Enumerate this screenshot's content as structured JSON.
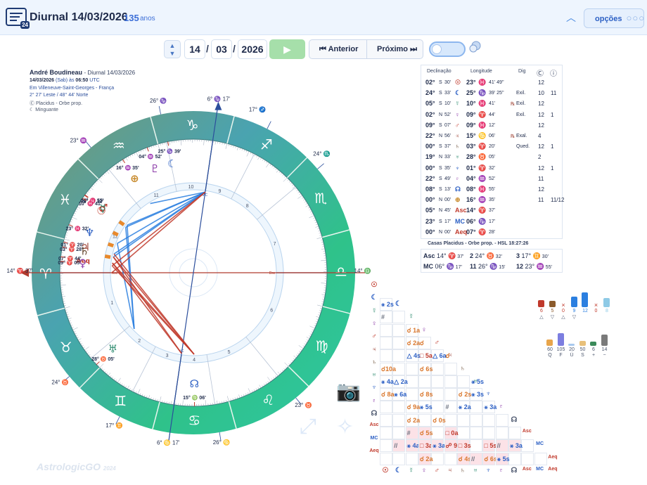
{
  "header": {
    "title": "Diurnal 14/03/2026",
    "age_value": "135",
    "age_unit": "anos",
    "logo_badge": "24",
    "options_label": "opções"
  },
  "toolbar": {
    "day": "14",
    "month": "03",
    "year": "2026",
    "prev_label": "Anterior",
    "next_label": "Próximo"
  },
  "chart_info": {
    "name": "André Boudineau",
    "chart_label": "- Diurnal 14/03/2026",
    "date": "14/03/2026",
    "weekday_note": "(Sab) às",
    "time": "06:50",
    "tz": "UTC",
    "place_prefix": "Em",
    "place": "Villeneuve-Saint-Georges - França",
    "coords": "2° 27' Leste / 48° 44' Norte",
    "house_system": "Placidus - Orbe prop.",
    "moon_phase": "Minguante"
  },
  "wheel": {
    "cusp_labels": [
      {
        "text": "14°",
        "sub": "37'",
        "sign": "♈"
      },
      {
        "text": "14°",
        "sub": "37'",
        "sign": "♎"
      },
      {
        "text": "6°",
        "sub": "17'",
        "sign": "♑"
      },
      {
        "text": "6°",
        "sub": "17'",
        "sign": "♋"
      },
      {
        "text": "26°",
        "sign": "♑"
      },
      {
        "text": "17°",
        "sign": "♐"
      },
      {
        "text": "24°",
        "sign": "♏"
      },
      {
        "text": "23°",
        "sign": "♒"
      },
      {
        "text": "23°",
        "sign": "♉"
      },
      {
        "text": "24°",
        "sign": "♉"
      },
      {
        "text": "17°",
        "sign": "♊"
      },
      {
        "text": "26°",
        "sign": "♋"
      }
    ],
    "house_numbers": [
      "1",
      "2",
      "3",
      "4",
      "5",
      "6",
      "7",
      "8",
      "9",
      "10",
      "11",
      "12"
    ],
    "angles": {
      "asc": "Asc",
      "dsc": "Dsc",
      "mc": "MC",
      "ic": "IC"
    },
    "planets": [
      {
        "glyph": "♇",
        "deg": "04°",
        "sign": "♒",
        "min": "52'",
        "color": "#8b3aa8"
      },
      {
        "glyph": "☾",
        "deg": "25°",
        "sign": "♑",
        "min": "39'",
        "color": "#2b5fc4"
      },
      {
        "glyph": "⊕",
        "deg": "16°",
        "sign": "♒",
        "min": "35'",
        "color": "#c78a2b"
      },
      {
        "glyph": "♂",
        "deg": "08°",
        "sign": "♓",
        "min": "55'",
        "color": "#c0392b"
      },
      {
        "glyph": "☿",
        "deg": "09°",
        "sign": "♓",
        "min": "12'",
        "color": "#2b8a6e"
      },
      {
        "glyph": "☉",
        "deg": "10°",
        "sign": "♓",
        "min": "41'",
        "color": "#c0392b"
      },
      {
        "glyph": "♆",
        "deg": "23°",
        "sign": "♓",
        "min": "32'",
        "color": "#2b5fc4"
      },
      {
        "glyph": "♃",
        "deg": "01°",
        "sign": "♈",
        "min": "20'",
        "color": "#9a3b2c"
      },
      {
        "glyph": "♄",
        "deg": "03°",
        "sign": "♈",
        "min": "28'",
        "color": "#5a3a20"
      },
      {
        "glyph": "Aeq",
        "deg": "07°",
        "sign": "♈",
        "min": "44'",
        "color": "#c0392b"
      },
      {
        "glyph": "♀",
        "deg": "09°",
        "sign": "♈",
        "min": "05'",
        "color": "#8b3aa8"
      },
      {
        "glyph": "♅",
        "deg": "28°",
        "sign": "♉",
        "min": "05'",
        "color": "#2b8a6e"
      },
      {
        "glyph": "☊",
        "deg": "15°",
        "sign": "♍",
        "min": "06'",
        "color": "#2b5fc4"
      }
    ]
  },
  "positions": {
    "headers": {
      "decl": "Declinação",
      "long": "Longitude",
      "dig": "Dig"
    },
    "rows": [
      {
        "deg": "02°",
        "dir": "S",
        "min": "30'",
        "pl": "☉",
        "pc": "#c0392b",
        "ldeg": "23°",
        "sg": "♓",
        "sc": "#2b5fc4",
        "lmin": "41' 49''",
        "rx": "",
        "dig": "",
        "c1": "12",
        "c2": ""
      },
      {
        "deg": "24°",
        "dir": "S",
        "min": "33'",
        "pl": "☾",
        "pc": "#2b5fc4",
        "ldeg": "25°",
        "sg": "♑",
        "sc": "#5a3a20",
        "lmin": "39' 25''",
        "rx": "",
        "dig": "Exil.",
        "c1": "10",
        "c2": "11"
      },
      {
        "deg": "05°",
        "dir": "S",
        "min": "10'",
        "pl": "☿",
        "pc": "#2b8a6e",
        "ldeg": "10°",
        "sg": "♓",
        "sc": "#2b5fc4",
        "lmin": "41'",
        "rx": "℞",
        "dig": "Exil.",
        "c1": "12",
        "c2": ""
      },
      {
        "deg": "02°",
        "dir": "N",
        "min": "52'",
        "pl": "♀",
        "pc": "#8b3aa8",
        "ldeg": "09°",
        "sg": "♈",
        "sc": "#c0392b",
        "lmin": "44'",
        "rx": "",
        "dig": "Exil.",
        "c1": "12",
        "c2": "1"
      },
      {
        "deg": "09°",
        "dir": "S",
        "min": "07'",
        "pl": "♂",
        "pc": "#c0392b",
        "ldeg": "09°",
        "sg": "♓",
        "sc": "#2b5fc4",
        "lmin": "12'",
        "rx": "",
        "dig": "",
        "c1": "12",
        "c2": ""
      },
      {
        "deg": "22°",
        "dir": "N",
        "min": "56'",
        "pl": "♃",
        "pc": "#9a3b2c",
        "ldeg": "15°",
        "sg": "♋",
        "sc": "#2b8a6e",
        "lmin": "06'",
        "rx": "℞",
        "dig": "Exal.",
        "c1": "4",
        "c2": ""
      },
      {
        "deg": "00°",
        "dir": "S",
        "min": "37'",
        "pl": "♄",
        "pc": "#5a3a20",
        "ldeg": "03°",
        "sg": "♈",
        "sc": "#c0392b",
        "lmin": "20'",
        "rx": "",
        "dig": "Qued.",
        "c1": "12",
        "c2": "1"
      },
      {
        "deg": "19°",
        "dir": "N",
        "min": "33'",
        "pl": "♅",
        "pc": "#2b8a6e",
        "ldeg": "28°",
        "sg": "♉",
        "sc": "#2b8a6e",
        "lmin": "05'",
        "rx": "",
        "dig": "",
        "c1": "2",
        "c2": ""
      },
      {
        "deg": "00°",
        "dir": "S",
        "min": "35'",
        "pl": "♆",
        "pc": "#2b5fc4",
        "ldeg": "01°",
        "sg": "♈",
        "sc": "#c0392b",
        "lmin": "32'",
        "rx": "",
        "dig": "",
        "c1": "12",
        "c2": "1"
      },
      {
        "deg": "22°",
        "dir": "S",
        "min": "49'",
        "pl": "♇",
        "pc": "#8b3aa8",
        "ldeg": "04°",
        "sg": "♒",
        "sc": "#2b5fc4",
        "lmin": "52'",
        "rx": "",
        "dig": "",
        "c1": "11",
        "c2": ""
      },
      {
        "deg": "08°",
        "dir": "S",
        "min": "13'",
        "pl": "☊",
        "pc": "#2b5fc4",
        "ldeg": "08°",
        "sg": "♓",
        "sc": "#2b5fc4",
        "lmin": "55'",
        "rx": "",
        "dig": "",
        "c1": "12",
        "c2": ""
      },
      {
        "deg": "00°",
        "dir": "N",
        "min": "00'",
        "pl": "⊕",
        "pc": "#c78a2b",
        "ldeg": "16°",
        "sg": "♒",
        "sc": "#2b5fc4",
        "lmin": "35'",
        "rx": "",
        "dig": "",
        "c1": "11",
        "c2": "11/12"
      },
      {
        "deg": "05°",
        "dir": "N",
        "min": "45'",
        "pl": "Asc",
        "pc": "#c0392b",
        "ldeg": "14°",
        "sg": "♈",
        "sc": "#c0392b",
        "lmin": "37'",
        "rx": "",
        "dig": "",
        "c1": "",
        "c2": ""
      },
      {
        "deg": "23°",
        "dir": "S",
        "min": "17'",
        "pl": "MC",
        "pc": "#2b5fc4",
        "ldeg": "06°",
        "sg": "♑",
        "sc": "#5a3a20",
        "lmin": "17'",
        "rx": "",
        "dig": "",
        "c1": "",
        "c2": ""
      },
      {
        "deg": "00°",
        "dir": "N",
        "min": "00'",
        "pl": "Aeq",
        "pc": "#c0392b",
        "ldeg": "07°",
        "sg": "♈",
        "sc": "#c0392b",
        "lmin": "28'",
        "rx": "",
        "dig": "",
        "c1": "",
        "c2": ""
      }
    ]
  },
  "houses": {
    "title": "Casas Placidus - Orbe prop. - HSL 18:27:26",
    "cells": [
      {
        "n": "Asc",
        "deg": "14°",
        "sg": "♈",
        "sc": "#c0392b",
        "min": "37'"
      },
      {
        "n": "2",
        "deg": "24°",
        "sg": "♉",
        "sc": "#2b8a6e",
        "min": "32'"
      },
      {
        "n": "3",
        "deg": "17°",
        "sg": "♊",
        "sc": "#c78a2b",
        "min": "30'"
      },
      {
        "n": "MC",
        "deg": "06°",
        "sg": "♑",
        "sc": "#5a3a20",
        "min": "17'"
      },
      {
        "n": "11",
        "deg": "26°",
        "sg": "♑",
        "sc": "#5a3a20",
        "min": "15'"
      },
      {
        "n": "12",
        "deg": "23°",
        "sg": "♒",
        "sc": "#2b5fc4",
        "min": "55'"
      }
    ]
  },
  "aspect_grid": {
    "row_glyphs": [
      "☉",
      "☾",
      "☿",
      "♀",
      "♂",
      "♃",
      "♄",
      "♅",
      "♆",
      "♇",
      "☊",
      "Asc",
      "MC",
      "Aeq"
    ],
    "row_colors": [
      "#c0392b",
      "#2b5fc4",
      "#2b8a6e",
      "#8b3aa8",
      "#c0392b",
      "#9a3b2c",
      "#5a3a20",
      "#2b8a6e",
      "#2b5fc4",
      "#8b3aa8",
      "#4b566d",
      "#c0392b",
      "#2b5fc4",
      "#c0392b"
    ],
    "cells": [
      {
        "r": 1,
        "c": 0,
        "t": "⚹ 2s",
        "k": "#2b5fc4"
      },
      {
        "r": 2,
        "c": 0,
        "t": "#",
        "k": "#6b7280"
      },
      {
        "r": 3,
        "c": 2,
        "t": "☌ 1a",
        "k": "#d9762b"
      },
      {
        "r": 4,
        "c": 2,
        "t": "☌ 2a",
        "k": "#d9762b"
      },
      {
        "r": 4,
        "c": 3,
        "t": "☌",
        "k": "#d9762b"
      },
      {
        "r": 5,
        "c": 2,
        "t": "△ 4s",
        "k": "#2b5fc4"
      },
      {
        "r": 5,
        "c": 3,
        "t": "□ 5a",
        "k": "#c0392b"
      },
      {
        "r": 5,
        "c": 4,
        "t": "△ 6a",
        "k": "#2b5fc4"
      },
      {
        "r": 5,
        "c": 5,
        "t": "☌",
        "k": "#d9762b"
      },
      {
        "r": 6,
        "c": 0,
        "t": "☌10a",
        "k": "#d9762b"
      },
      {
        "r": 6,
        "c": 3,
        "t": "☌ 6s",
        "k": "#d9762b"
      },
      {
        "r": 7,
        "c": 0,
        "t": "⚹ 4a",
        "k": "#2b5fc4"
      },
      {
        "r": 7,
        "c": 1,
        "t": "△ 2a",
        "k": "#2b5fc4"
      },
      {
        "r": 7,
        "c": 7,
        "t": "⚹ 5s",
        "k": "#2b5fc4"
      },
      {
        "r": 8,
        "c": 0,
        "t": "☌ 8a",
        "k": "#d9762b"
      },
      {
        "r": 8,
        "c": 1,
        "t": "⚹ 6a",
        "k": "#2b5fc4"
      },
      {
        "r": 8,
        "c": 3,
        "t": "☌ 8s",
        "k": "#d9762b"
      },
      {
        "r": 8,
        "c": 6,
        "t": "☌ 2s",
        "k": "#d9762b"
      },
      {
        "r": 8,
        "c": 7,
        "t": "⚹ 3s",
        "k": "#2b5fc4"
      },
      {
        "r": 9,
        "c": 2,
        "t": "☌ 9a",
        "k": "#d9762b"
      },
      {
        "r": 9,
        "c": 3,
        "t": "⚹ 5s",
        "k": "#2b5fc4"
      },
      {
        "r": 9,
        "c": 5,
        "t": "#",
        "k": "#6b7280"
      },
      {
        "r": 9,
        "c": 6,
        "t": "⚹ 2a",
        "k": "#2b5fc4"
      },
      {
        "r": 9,
        "c": 8,
        "t": "⚹ 3a",
        "k": "#2b5fc4"
      },
      {
        "r": 10,
        "c": 2,
        "t": "☌ 2a",
        "k": "#d9762b"
      },
      {
        "r": 10,
        "c": 4,
        "t": "☌ 0s",
        "k": "#d9762b"
      },
      {
        "r": 11,
        "c": 2,
        "t": "#",
        "k": "#6b7280"
      },
      {
        "r": 11,
        "c": 3,
        "t": "☌ 5s",
        "k": "#d9762b"
      },
      {
        "r": 11,
        "c": 5,
        "t": "□ 0a",
        "k": "#c0392b"
      },
      {
        "r": 12,
        "c": 1,
        "t": "//",
        "k": "#6b7280"
      },
      {
        "r": 12,
        "c": 2,
        "t": "⚹ 4a",
        "k": "#2b5fc4"
      },
      {
        "r": 12,
        "c": 3,
        "t": "□ 3a",
        "k": "#c0392b"
      },
      {
        "r": 12,
        "c": 4,
        "t": "⚹ 3a",
        "k": "#2b5fc4"
      },
      {
        "r": 12,
        "c": 5,
        "t": "☍ 9a",
        "k": "#c0392b"
      },
      {
        "r": 12,
        "c": 6,
        "t": "□ 3s",
        "k": "#c0392b"
      },
      {
        "r": 12,
        "c": 8,
        "t": "□ 5s",
        "k": "#c0392b"
      },
      {
        "r": 12,
        "c": 9,
        "t": "//",
        "k": "#6b7280"
      },
      {
        "r": 12,
        "c": 10,
        "t": "⚹ 3a",
        "k": "#2b5fc4"
      },
      {
        "r": 13,
        "c": 3,
        "t": "☌ 2a",
        "k": "#d9762b"
      },
      {
        "r": 13,
        "c": 6,
        "t": "☌ 4s",
        "k": "#d9762b"
      },
      {
        "r": 13,
        "c": 7,
        "t": "//",
        "k": "#6b7280"
      },
      {
        "r": 13,
        "c": 8,
        "t": "☌ 6s",
        "k": "#d9762b"
      },
      {
        "r": 13,
        "c": 9,
        "t": "⚹ 5s",
        "k": "#2b5fc4"
      }
    ]
  },
  "elements_chart": {
    "top": [
      {
        "v": "6",
        "sym": "△",
        "c": "#c0392b",
        "h": 0.35
      },
      {
        "v": "5",
        "sym": "▽",
        "c": "#8b5a2b",
        "h": 0.3
      },
      {
        "v": "0",
        "sym": "△",
        "c": "#c0392b",
        "h": 0.0,
        "x": true
      },
      {
        "v": "9",
        "sym": "▽",
        "c": "#2b7fe0",
        "h": 0.5
      },
      {
        "v": "12",
        "sym": "",
        "c": "#2b7fe0",
        "h": 0.7
      },
      {
        "v": "0",
        "sym": "",
        "c": "#c0392b",
        "h": 0.0,
        "x": true
      },
      {
        "v": "8",
        "sym": "",
        "c": "#8ecae6",
        "h": 0.45
      }
    ],
    "bottom": [
      {
        "v": "60",
        "sym": "Q",
        "c": "#e8a54b",
        "h": 0.3
      },
      {
        "v": "105",
        "sym": "F",
        "c": "#7c7ee0",
        "h": 0.6
      },
      {
        "v": "20",
        "sym": "Ú",
        "c": "#a8c9ee",
        "h": 0.1
      },
      {
        "v": "50",
        "sym": "S",
        "c": "#e8c07a",
        "h": 0.25
      },
      {
        "v": "6",
        "sym": "+",
        "c": "#3b8a5a",
        "h": 0.2
      },
      {
        "v": "14",
        "sym": "−",
        "c": "#7a7a7a",
        "h": 0.55
      }
    ]
  },
  "brand": {
    "name": "Astrologic",
    "suffix": "GO",
    "year": "2024"
  }
}
